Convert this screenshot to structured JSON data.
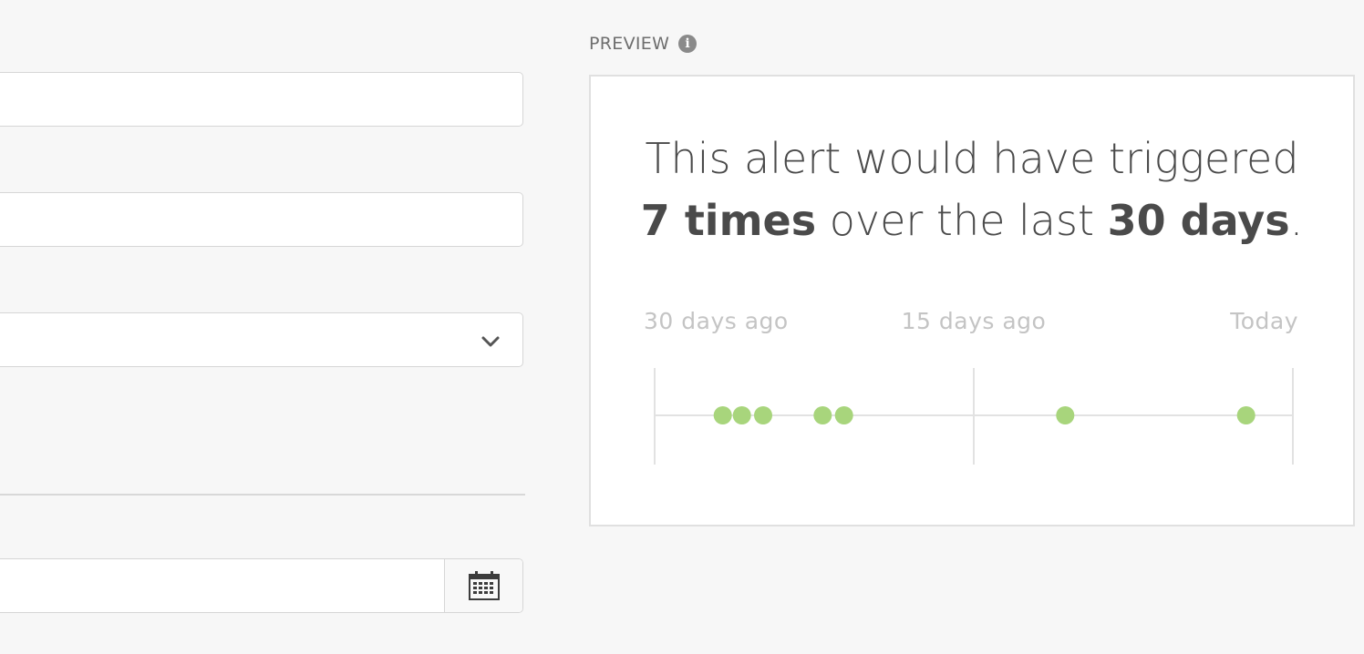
{
  "form": {
    "calendar_icon": "calendar-icon",
    "dropdown_icon": "chevron-down-icon"
  },
  "preview": {
    "label": "PREVIEW",
    "info_icon": "info-icon",
    "headline_line1": "This alert would have triggered",
    "count_text": "7 times",
    "middle_text": " over the last ",
    "period_text": "30 days",
    "end_text": ".",
    "accent_color": "#a8d57c"
  },
  "chart_data": {
    "type": "scatter",
    "x_unit": "days ago",
    "xlim": [
      30,
      0
    ],
    "tick_labels": [
      "30 days ago",
      "15 days ago",
      "Today"
    ],
    "tick_values": [
      30,
      15,
      0
    ],
    "events_days_ago": [
      26.8,
      25.9,
      24.9,
      22.1,
      21.1,
      10.7,
      2.2
    ]
  }
}
